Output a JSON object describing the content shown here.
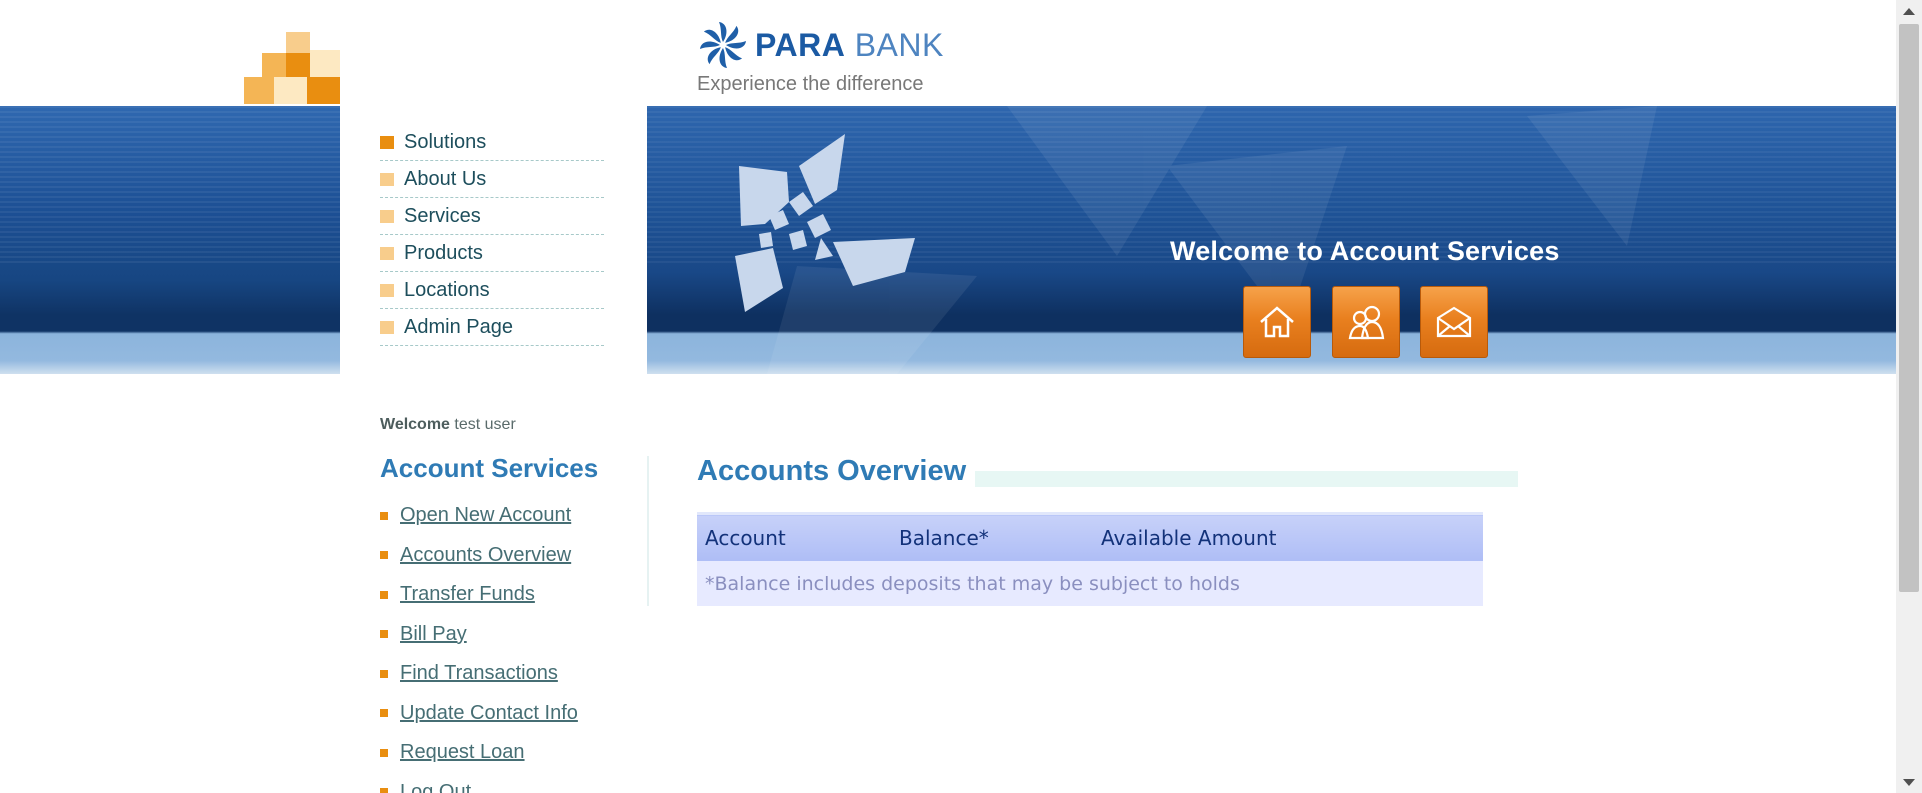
{
  "header": {
    "brand_part1": "PARA",
    "brand_part2": "BANK",
    "tagline": "Experience the difference",
    "banner_text": "Welcome to Account Services",
    "buttons": [
      {
        "name": "home",
        "icon": "home-icon"
      },
      {
        "name": "about",
        "icon": "people-icon"
      },
      {
        "name": "contact",
        "icon": "envelope-icon"
      }
    ]
  },
  "main_menu": [
    {
      "label": "Solutions",
      "active": true
    },
    {
      "label": "About Us"
    },
    {
      "label": "Services"
    },
    {
      "label": "Products"
    },
    {
      "label": "Locations"
    },
    {
      "label": "Admin Page"
    }
  ],
  "sidebar": {
    "welcome_word": "Welcome",
    "user_name": "test user",
    "title": "Account Services",
    "links": [
      {
        "label": "Open New Account"
      },
      {
        "label": "Accounts Overview"
      },
      {
        "label": "Transfer Funds"
      },
      {
        "label": "Bill Pay"
      },
      {
        "label": "Find Transactions"
      },
      {
        "label": "Update Contact Info"
      },
      {
        "label": "Request Loan"
      },
      {
        "label": "Log Out"
      }
    ]
  },
  "content": {
    "title": "Accounts Overview",
    "table": {
      "headers": [
        "Account",
        "Balance*",
        "Available Amount"
      ],
      "footnote": "*Balance includes deposits that may be subject to holds"
    }
  },
  "colors": {
    "accent_orange": "#e98e10",
    "heading_blue": "#2f7bb5",
    "band_blue": "#1c4f94"
  }
}
